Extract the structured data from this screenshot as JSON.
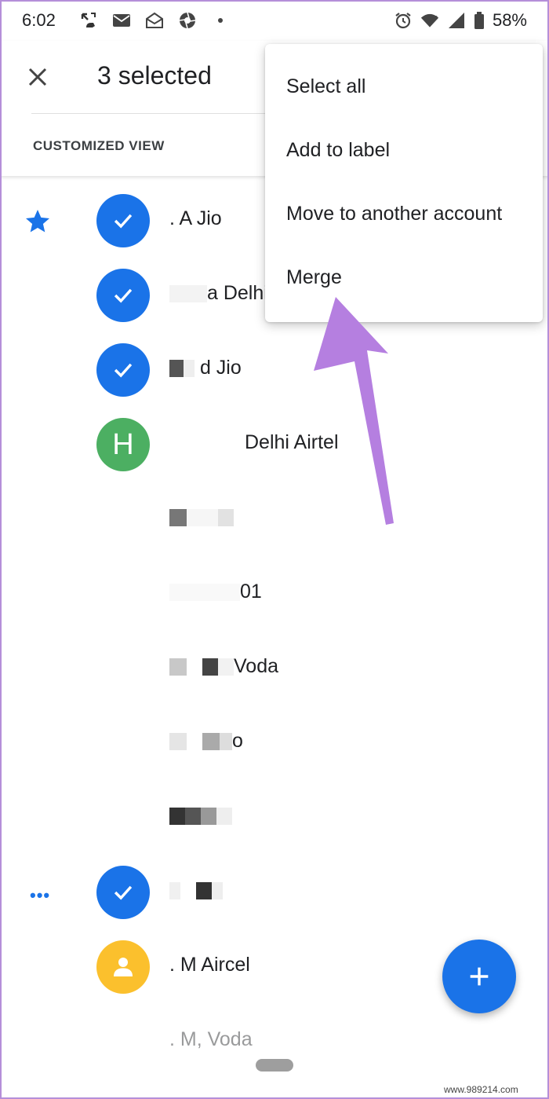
{
  "status_bar": {
    "time": "6:02",
    "battery": "58%",
    "left_icons": [
      "missed-call-icon",
      "mail-icon",
      "mail-open-icon",
      "aperture-icon",
      "dot-icon"
    ],
    "right_icons": [
      "alarm-icon",
      "wifi-icon",
      "signal-icon",
      "battery-icon"
    ]
  },
  "app_bar": {
    "title": "3 selected",
    "view_label": "CUSTOMIZED VIEW"
  },
  "menu": {
    "items": [
      "Select all",
      "Add to label",
      "Move to another account",
      "Merge"
    ]
  },
  "contacts": [
    {
      "name": ". A Jio",
      "avatar": "checked",
      "starred": true
    },
    {
      "name": "a Delhi",
      "avatar": "checked"
    },
    {
      "name": "d Jio",
      "avatar": "checked"
    },
    {
      "name": "Delhi Airtel",
      "avatar": "letter",
      "letter": "H"
    },
    {
      "name": "",
      "avatar": "photo"
    },
    {
      "name": "01",
      "avatar": "photo"
    },
    {
      "name": "Voda",
      "avatar": "photo"
    },
    {
      "name": "o",
      "avatar": "photo"
    },
    {
      "name": "",
      "avatar": "photo"
    },
    {
      "name": "",
      "avatar": "checked",
      "more": true
    },
    {
      "name": ". M Aircel",
      "avatar": "person"
    },
    {
      "name": ". M, Voda",
      "avatar": "photo"
    }
  ],
  "fab": {
    "icon": "plus-icon"
  },
  "watermark": "www.989214.com",
  "colors": {
    "accent": "#1a73e8",
    "green_avatar": "#4caf62",
    "yellow_avatar": "#fbc02d",
    "annotation_arrow": "#b57fe0"
  }
}
